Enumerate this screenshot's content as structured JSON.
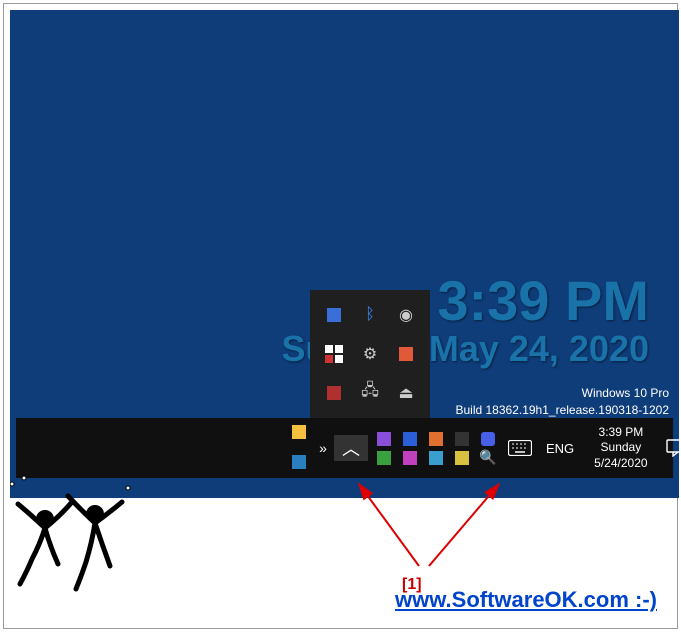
{
  "desktop": {
    "clock_time": "3:39 PM",
    "clock_date": "Sunday, May 24, 2020",
    "edition": "Windows 10 Pro",
    "build": "Build 18362.19h1_release.190318-1202"
  },
  "tray_flyout_icons": [
    "intel-graphics-icon",
    "bluetooth-icon",
    "nvidia-icon",
    "windows-security-icon",
    "settings-gear-icon",
    "file-explorer-icon",
    "save-disk-icon",
    "network-icon",
    "usb-eject-icon"
  ],
  "taskbar": {
    "left_icons": [
      "folder-icon",
      "app-icon",
      "chevrons-right-icon"
    ],
    "chevron_up": "︿",
    "tray_icons": [
      "app-purple-icon",
      "app-blue-icon",
      "power-icon",
      "placeholder-icon",
      "shield-check-icon",
      "app-green-icon",
      "app-magenta-icon",
      "app-cyan-icon",
      "app-yellow-icon",
      "magnifier-icon"
    ],
    "language": "ENG",
    "clock_time": "3:39 PM",
    "clock_day": "Sunday",
    "clock_date": "5/24/2020"
  },
  "annotation": {
    "label": "[1]"
  },
  "footer": {
    "url": "www.SoftwareOK.com :-)"
  }
}
